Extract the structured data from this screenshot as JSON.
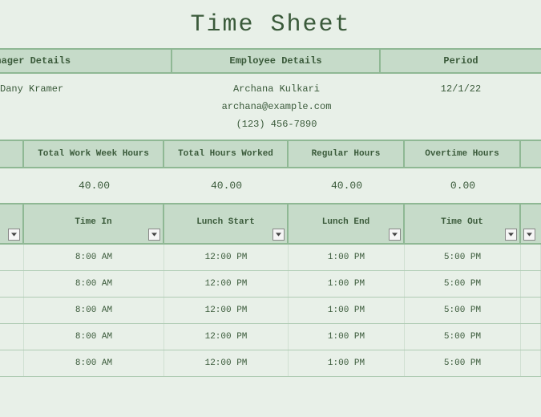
{
  "title": "Time Sheet",
  "headers": {
    "manager": "Manager Details",
    "employee": "Employee Details",
    "period": "Period"
  },
  "manager": {
    "name": "Dany Kramer"
  },
  "employee": {
    "name": "Archana Kulkari",
    "email": "archana@example.com",
    "phone": "(123) 456-7890"
  },
  "period": "12/1/22",
  "summary_headers": {
    "total_week": "Total Work Week Hours",
    "total_worked": "Total Hours Worked",
    "regular": "Regular Hours",
    "overtime": "Overtime Hours"
  },
  "summary": {
    "total_week": "40.00",
    "total_worked": "40.00",
    "regular": "40.00",
    "overtime": "0.00"
  },
  "time_headers": {
    "time_in": "Time In",
    "lunch_start": "Lunch Start",
    "lunch_end": "Lunch End",
    "time_out": "Time Out"
  },
  "rows": [
    {
      "time_in": "8:00 AM",
      "lunch_start": "12:00 PM",
      "lunch_end": "1:00 PM",
      "time_out": "5:00 PM"
    },
    {
      "time_in": "8:00 AM",
      "lunch_start": "12:00 PM",
      "lunch_end": "1:00 PM",
      "time_out": "5:00 PM"
    },
    {
      "time_in": "8:00 AM",
      "lunch_start": "12:00 PM",
      "lunch_end": "1:00 PM",
      "time_out": "5:00 PM"
    },
    {
      "time_in": "8:00 AM",
      "lunch_start": "12:00 PM",
      "lunch_end": "1:00 PM",
      "time_out": "5:00 PM"
    },
    {
      "time_in": "8:00 AM",
      "lunch_start": "12:00 PM",
      "lunch_end": "1:00 PM",
      "time_out": "5:00 PM"
    }
  ]
}
